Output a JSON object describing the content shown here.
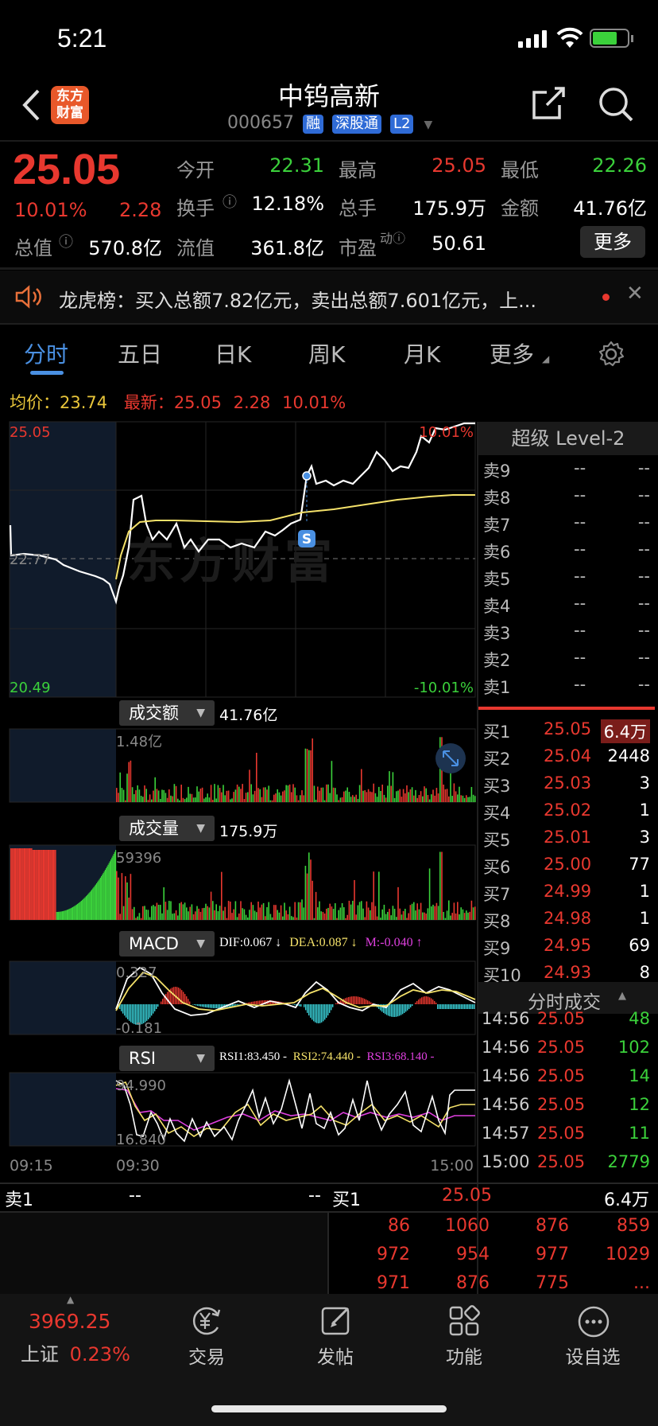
{
  "status_bar": {
    "time": "5:21"
  },
  "header": {
    "back": "‹",
    "logo": "东方\n财富",
    "title": "中钨高新",
    "code": "000657",
    "badges": [
      "融",
      "深股通",
      "L2"
    ]
  },
  "quote": {
    "price": "25.05",
    "pct": "10.01%",
    "change": "2.28",
    "fields": [
      {
        "label": "今开",
        "value": "22.31",
        "color": "green"
      },
      {
        "label": "最高",
        "value": "25.05",
        "color": "red"
      },
      {
        "label": "最低",
        "value": "22.26",
        "color": "green"
      },
      {
        "label": "换手",
        "value": "12.18%",
        "color": "white"
      },
      {
        "label": "总手",
        "value": "175.9万",
        "color": "white"
      },
      {
        "label": "金额",
        "value": "41.76亿",
        "color": "white"
      },
      {
        "label": "总值",
        "value": "570.8亿",
        "color": "white"
      },
      {
        "label": "流值",
        "value": "361.8亿",
        "color": "white"
      },
      {
        "label": "市盈",
        "value": "50.61",
        "color": "white"
      }
    ],
    "more_button": "更多"
  },
  "notice": {
    "text": "龙虎榜：买入总额7.82亿元，卖出总额7.601亿元，上..."
  },
  "tabs": [
    "分时",
    "五日",
    "日K",
    "周K",
    "月K",
    "更多"
  ],
  "summary": {
    "avg_label": "均价：",
    "avg_value": "23.74",
    "latest_label": "最新：",
    "latest_value": "25.05",
    "change": "2.28",
    "pct": "10.01%"
  },
  "chart": {
    "price_high": "25.05",
    "price_mid": "22.77",
    "price_low": "20.49",
    "pct_high": "10.01%",
    "pct_low": "-10.01%",
    "watermark": "东方财富",
    "marker": "S",
    "times": [
      "09:15",
      "09:30",
      "15:00"
    ]
  },
  "indicators": {
    "amount": {
      "label": "成交额",
      "total": "41.76亿",
      "axis_max": "1.48亿"
    },
    "volume": {
      "label": "成交量",
      "total": "175.9万",
      "axis_max": "59396"
    },
    "macd": {
      "label": "MACD",
      "dif": "DIF:0.067 ↓",
      "dea": "DEA:0.087 ↓",
      "m": "M:-0.040 ↑",
      "axis_max": "0.327",
      "axis_min": "-0.181"
    },
    "rsi": {
      "label": "RSI",
      "rsi1": "RSI1:83.450 -",
      "rsi2": "RSI2:74.440 -",
      "rsi3": "RSI3:68.140 -",
      "axis_max": "94.990",
      "axis_min": "16.840"
    }
  },
  "level2": {
    "title": "超级 Level-2",
    "asks": [
      {
        "l": "卖9",
        "p": "--",
        "v": "--"
      },
      {
        "l": "卖8",
        "p": "--",
        "v": "--"
      },
      {
        "l": "卖7",
        "p": "--",
        "v": "--"
      },
      {
        "l": "卖6",
        "p": "--",
        "v": "--"
      },
      {
        "l": "卖5",
        "p": "--",
        "v": "--"
      },
      {
        "l": "卖4",
        "p": "--",
        "v": "--"
      },
      {
        "l": "卖3",
        "p": "--",
        "v": "--"
      },
      {
        "l": "卖2",
        "p": "--",
        "v": "--"
      },
      {
        "l": "卖1",
        "p": "--",
        "v": "--"
      }
    ],
    "bids": [
      {
        "l": "买1",
        "p": "25.05",
        "v": "6.4万"
      },
      {
        "l": "买2",
        "p": "25.04",
        "v": "2448"
      },
      {
        "l": "买3",
        "p": "25.03",
        "v": "3"
      },
      {
        "l": "买4",
        "p": "25.02",
        "v": "1"
      },
      {
        "l": "买5",
        "p": "25.01",
        "v": "3"
      },
      {
        "l": "买6",
        "p": "25.00",
        "v": "77"
      },
      {
        "l": "买7",
        "p": "24.99",
        "v": "1"
      },
      {
        "l": "买8",
        "p": "24.98",
        "v": "1"
      },
      {
        "l": "买9",
        "p": "24.95",
        "v": "69"
      },
      {
        "l": "买10",
        "p": "24.93",
        "v": "8"
      }
    ]
  },
  "ticks": {
    "title": "分时成交",
    "rows": [
      {
        "t": "14:56",
        "p": "25.05",
        "v": "48",
        "c": "green"
      },
      {
        "t": "14:56",
        "p": "25.05",
        "v": "102",
        "c": "green"
      },
      {
        "t": "14:56",
        "p": "25.05",
        "v": "14",
        "c": "green"
      },
      {
        "t": "14:56",
        "p": "25.05",
        "v": "12",
        "c": "green"
      },
      {
        "t": "14:57",
        "p": "25.05",
        "v": "11",
        "c": "green"
      },
      {
        "t": "15:00",
        "p": "25.05",
        "v": "2779",
        "c": "green"
      }
    ]
  },
  "queue": {
    "sell_label": "卖1",
    "sell_p": "--",
    "sell_v": "--",
    "buy_label": "买1",
    "buy_p": "25.05",
    "buy_v": "6.4万",
    "rows": [
      [
        "86",
        "1060",
        "876",
        "859"
      ],
      [
        "972",
        "954",
        "977",
        "1029"
      ],
      [
        "971",
        "876",
        "775",
        "..."
      ]
    ]
  },
  "bottom_bar": {
    "index_value": "3969.25",
    "index_name": "上证",
    "index_pct": "0.23%",
    "items": [
      "交易",
      "发帖",
      "功能",
      "设自选"
    ]
  }
}
